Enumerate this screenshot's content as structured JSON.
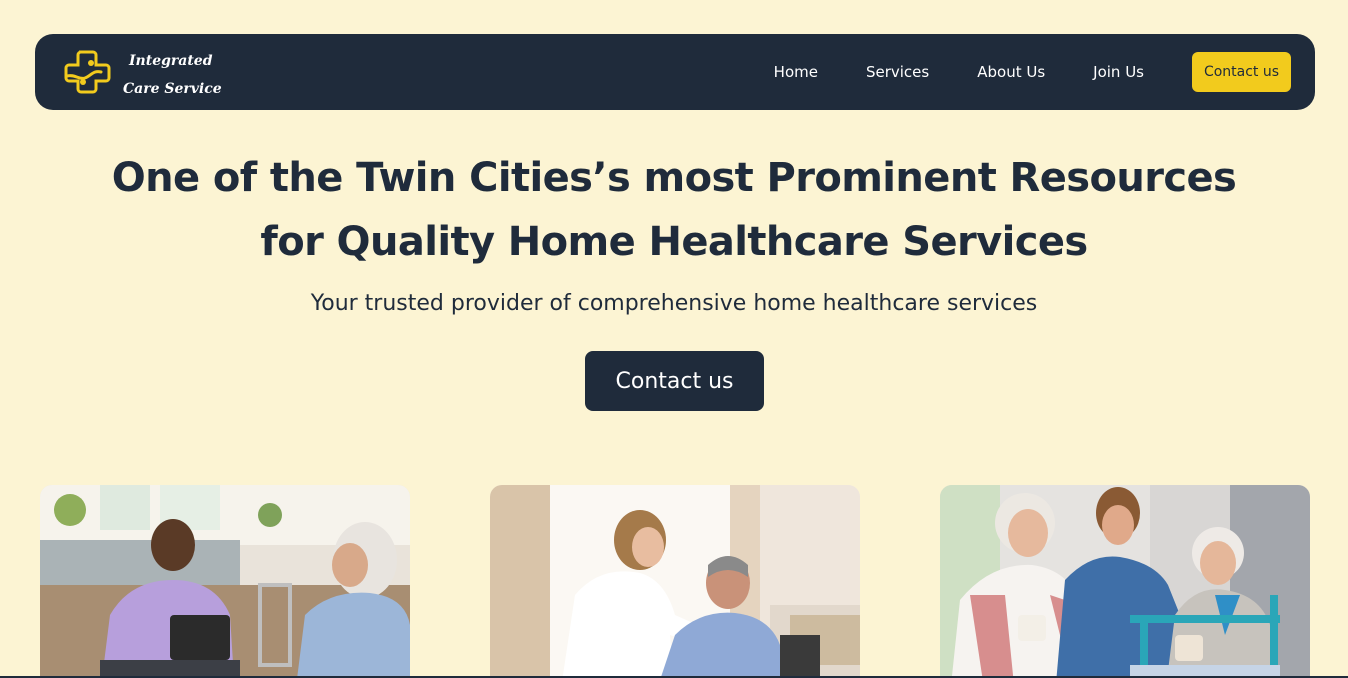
{
  "brand": {
    "line1": "Integrated",
    "line2": "Care Service",
    "accent_color": "#f2cb1d",
    "dark_color": "#1f2b3b",
    "background_color": "#fcf4d3"
  },
  "nav": {
    "items": [
      {
        "label": "Home"
      },
      {
        "label": "Services"
      },
      {
        "label": "About Us"
      },
      {
        "label": "Join Us"
      }
    ],
    "cta_label": "Contact us"
  },
  "hero": {
    "title_line1": "One of the Twin Cities’s most Prominent Resources",
    "title_line2": "for Quality Home Healthcare Services",
    "subtitle": "Your trusted provider of comprehensive home healthcare services",
    "cta_label": "Contact us"
  },
  "cards": [
    {
      "image": "caregiver-with-clipboard-and-senior-woman-photo"
    },
    {
      "image": "nurse-adjusting-senior-man-collar-photo"
    },
    {
      "image": "nurse-with-two-senior-women-photo"
    }
  ]
}
